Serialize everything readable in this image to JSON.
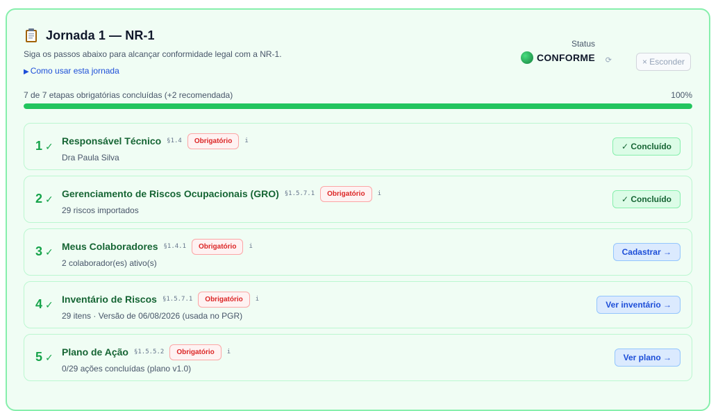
{
  "header": {
    "title": "Jornada 1 — NR-1",
    "subtitle": "Siga os passos abaixo para alcançar conformidade legal com a NR-1.",
    "howto_link": "Como usar esta jornada",
    "howto_marker": "▶",
    "status_label": "Status",
    "status_value": "CONFORME",
    "refresh_glyph": "⟳",
    "hide_label": "× Esconder",
    "icon": "clipboard-icon"
  },
  "progress": {
    "text": "7 de 7 etapas obrigatórias concluídas (+2 recomendada)",
    "percent_label": "100%",
    "percent": 100
  },
  "colors": {
    "accent_green": "#22c55e",
    "required_red": "#dc2626",
    "link_blue": "#1d4ed8"
  },
  "steps": [
    {
      "number": "1",
      "check": "✓",
      "title": "Responsável Técnico",
      "section": "§1.4",
      "badge": "Obrigatório",
      "info": "i",
      "subtitle": "Dra Paula Silva",
      "action": "✓ Concluído",
      "state": "done"
    },
    {
      "number": "2",
      "check": "✓",
      "title": "Gerenciamento de Riscos Ocupacionais (GRO)",
      "section": "§1.5.7.1",
      "badge": "Obrigatório",
      "info": "i",
      "subtitle": "29 riscos importados",
      "action": "✓ Concluído",
      "state": "done"
    },
    {
      "number": "3",
      "check": "✓",
      "title": "Meus Colaboradores",
      "section": "§1.4.1",
      "badge": "Obrigatório",
      "info": "i",
      "subtitle": "2 colaborador(es) ativo(s)",
      "action": "Cadastrar →",
      "state": "todo"
    },
    {
      "number": "4",
      "check": "✓",
      "title": "Inventário de Riscos",
      "section": "§1.5.7.1",
      "badge": "Obrigatório",
      "info": "i",
      "subtitle": "29 itens · Versão de 06/08/2026 (usada no PGR)",
      "action": "Ver inventário →",
      "state": "todo"
    },
    {
      "number": "5",
      "check": "✓",
      "title": "Plano de Ação",
      "section": "§1.5.5.2",
      "badge": "Obrigatório",
      "info": "i",
      "subtitle": "0/29 ações concluídas (plano v1.0)",
      "action": "Ver plano →",
      "state": "todo"
    }
  ]
}
